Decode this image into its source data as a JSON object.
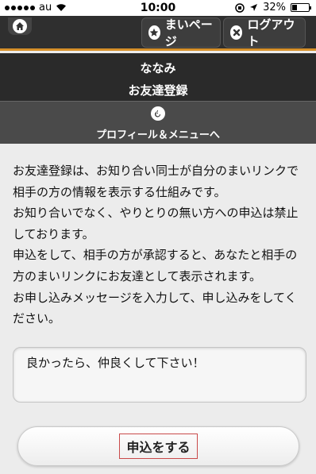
{
  "status": {
    "carrier": "au",
    "time": "10:00",
    "battery": "32%"
  },
  "header": {
    "home_icon": "home-icon",
    "mypage_label": "まいページ",
    "logout_label": "ログアウト"
  },
  "profile": {
    "name": "ななみ",
    "page_title": "お友達登録",
    "back_label": "プロフィール＆メニューへ"
  },
  "description": "お友達登録は、お知り合い同士が自分のまいリンクで相手の方の情報を表示する仕組みです。\nお知り合いでなく、やりとりの無い方への申込は禁止しております。\n申込をして、相手の方が承認すると、あなたと相手の方のまいリンクにお友達として表示されます。\nお申し込みメッセージを入力して、申し込みをしてください。",
  "message": {
    "value": "良かったら、仲良くして下さい！"
  },
  "submit_label": "申込をする",
  "colors": {
    "accent": "#d6902a",
    "header_bg": "#2f2f2f",
    "highlight_border": "#c94a4a"
  }
}
